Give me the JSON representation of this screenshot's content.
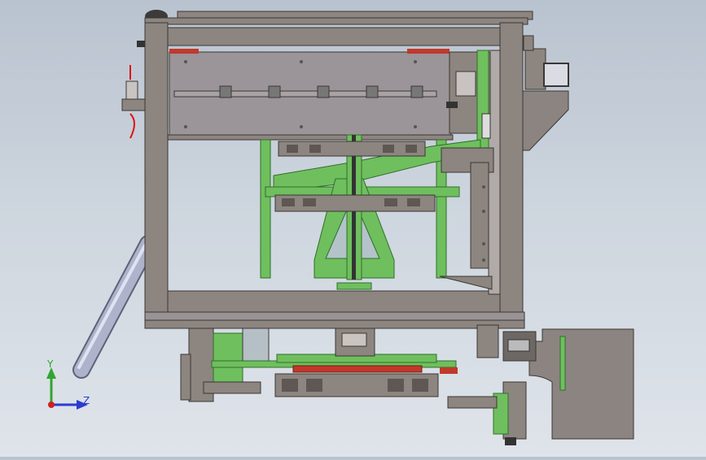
{
  "viewport": {
    "background_top": "#b9c3cf",
    "background_bottom": "#dfe4ea"
  },
  "colors": {
    "frame": "#8d8580",
    "frame_dark": "#5e5753",
    "plate": "#9a9396",
    "green": "#6fbf5e",
    "green_dark": "#2f6f2a",
    "red": "#c0392b",
    "tube": "#a7acc4"
  },
  "triad": {
    "y_label": "Y",
    "z_label": "Z",
    "y_color": "#2fa52f",
    "z_color": "#2a3ccf",
    "x_color": "#d02020"
  }
}
